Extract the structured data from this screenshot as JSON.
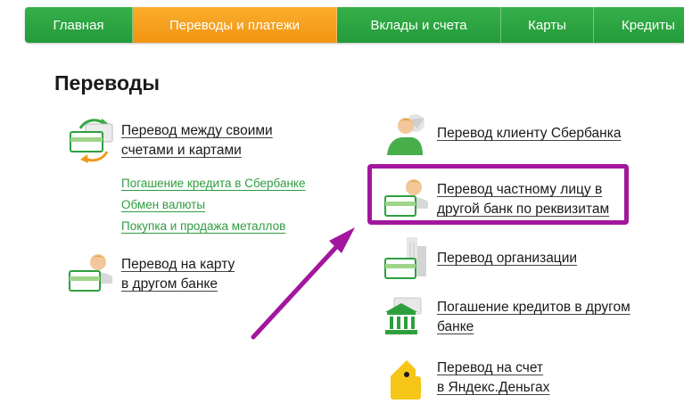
{
  "nav": {
    "items": [
      {
        "label": "Главная",
        "active": false
      },
      {
        "label": "Переводы и платежи",
        "active": true
      },
      {
        "label": "Вклады и счета",
        "active": false
      },
      {
        "label": "Карты",
        "active": false
      },
      {
        "label": "Кредиты",
        "active": false
      }
    ]
  },
  "page": {
    "title": "Переводы"
  },
  "left": {
    "own_transfer": {
      "line1": "Перевод между своими",
      "line2": "счетами и картами"
    },
    "links": [
      "Погашение кредита в Сбербанке",
      "Обмен валюты",
      "Покупка и продажа металлов"
    ],
    "card_transfer": {
      "line1": "Перевод на карту",
      "line2": "в другом банке"
    }
  },
  "right": {
    "sber_client": {
      "line1": "Перевод клиенту Сбербанка"
    },
    "private_person": {
      "line1": "Перевод частному лицу в",
      "line2": "другой банк по реквизитам"
    },
    "organization": {
      "line1": "Перевод организации"
    },
    "loan_other_bank": {
      "line1": "Погашение кредитов в другом",
      "line2": "банке"
    },
    "yandex": {
      "line1": "Перевод на счет",
      "line2": "в Яндекс.Деньгах"
    }
  },
  "colors": {
    "nav_green": "#2aa540",
    "nav_active_orange": "#f5a01e",
    "link_green": "#2f9c3f",
    "highlight_purple": "#a3169e"
  }
}
